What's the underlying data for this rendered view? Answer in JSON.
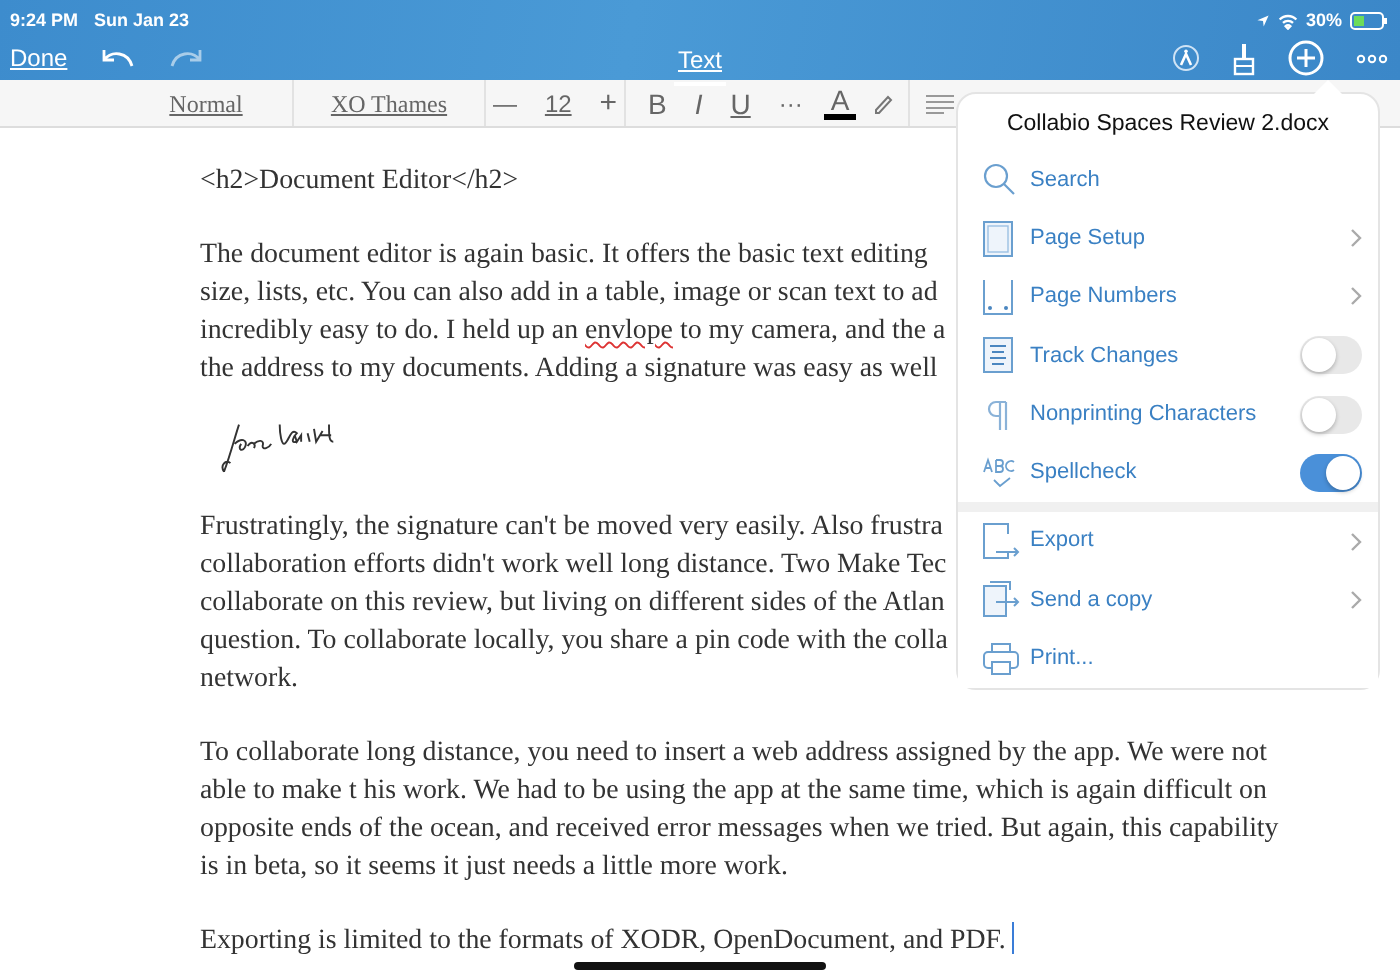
{
  "status_bar": {
    "time": "9:24 PM",
    "date": "Sun Jan 23",
    "battery": "30%"
  },
  "toolbar": {
    "done": "Done",
    "tab": {
      "label": "Text",
      "selected": true
    }
  },
  "format_bar": {
    "style": "Normal",
    "font": "XO Thames",
    "decrease": "—",
    "size": "12",
    "increase": "+",
    "bold": "B",
    "italic": "I",
    "underline": "U",
    "more": "···",
    "color_letter": "A"
  },
  "document": {
    "paragraphs": [
      {
        "lines": [
          [
            {
              "text": "<h2>Document Editor</h2>",
              "misspelled": false
            }
          ]
        ]
      },
      {
        "lines": [
          [
            {
              "text": "The document editor is again basic. It offers the basic text editing",
              "misspelled": false
            }
          ],
          [
            {
              "text": "size, lists, etc. You can also add in a table, image or scan text to ad",
              "misspelled": false
            }
          ],
          [
            {
              "text": "incredibly easy to do. I held up an ",
              "misspelled": false
            },
            {
              "text": "envlope",
              "misspelled": true
            },
            {
              "text": " to my camera, and the a",
              "misspelled": false
            }
          ],
          [
            {
              "text": "the address to my documents. Adding a signature was easy as well",
              "misspelled": false
            }
          ]
        ]
      },
      {
        "kind": "signature"
      },
      {
        "lines": [
          [
            {
              "text": "Frustratingly, the signature can't be moved very easily. Also frustra",
              "misspelled": false
            }
          ],
          [
            {
              "text": "collaboration efforts didn't work well long distance. Two Make Tec",
              "misspelled": false
            }
          ],
          [
            {
              "text": "collaborate on this review, but living on different sides of the Atlan",
              "misspelled": false
            }
          ],
          [
            {
              "text": "question. To collaborate locally, you share a pin code with the colla",
              "misspelled": false
            }
          ],
          [
            {
              "text": "network.",
              "misspelled": false
            }
          ]
        ]
      },
      {
        "lines": [
          [
            {
              "text": "To collaborate long distance, you need to insert a web address assigned by the app. We were not",
              "misspelled": false
            }
          ],
          [
            {
              "text": "able to make t his work. We had to be using the app at the same time, which is again difficult on",
              "misspelled": false
            }
          ],
          [
            {
              "text": "opposite ends of the ocean, and received error messages when we tried. But again, this capability",
              "misspelled": false
            }
          ],
          [
            {
              "text": "is in beta, so it seems it just needs a little more work.",
              "misspelled": false
            }
          ]
        ]
      },
      {
        "lines": [
          [
            {
              "text": "Exporting is limited to the formats of XODR, OpenDocument, and PDF.",
              "misspelled": false
            }
          ]
        ],
        "cursor": true
      }
    ]
  },
  "menu": {
    "title": "Collabio Spaces Review 2.docx",
    "sections": [
      {
        "items": [
          {
            "label": "Search",
            "kind": "action"
          },
          {
            "label": "Page Setup",
            "kind": "submenu"
          },
          {
            "label": "Page Numbers",
            "kind": "submenu"
          },
          {
            "label": "Track Changes",
            "kind": "toggle",
            "on": false
          },
          {
            "label": "Nonprinting Characters",
            "kind": "toggle",
            "on": false
          },
          {
            "label": "Spellcheck",
            "kind": "toggle",
            "on": true
          }
        ]
      },
      {
        "items": [
          {
            "label": "Export",
            "kind": "submenu"
          },
          {
            "label": "Send a copy",
            "kind": "submenu"
          },
          {
            "label": "Print...",
            "kind": "action"
          }
        ]
      }
    ]
  }
}
